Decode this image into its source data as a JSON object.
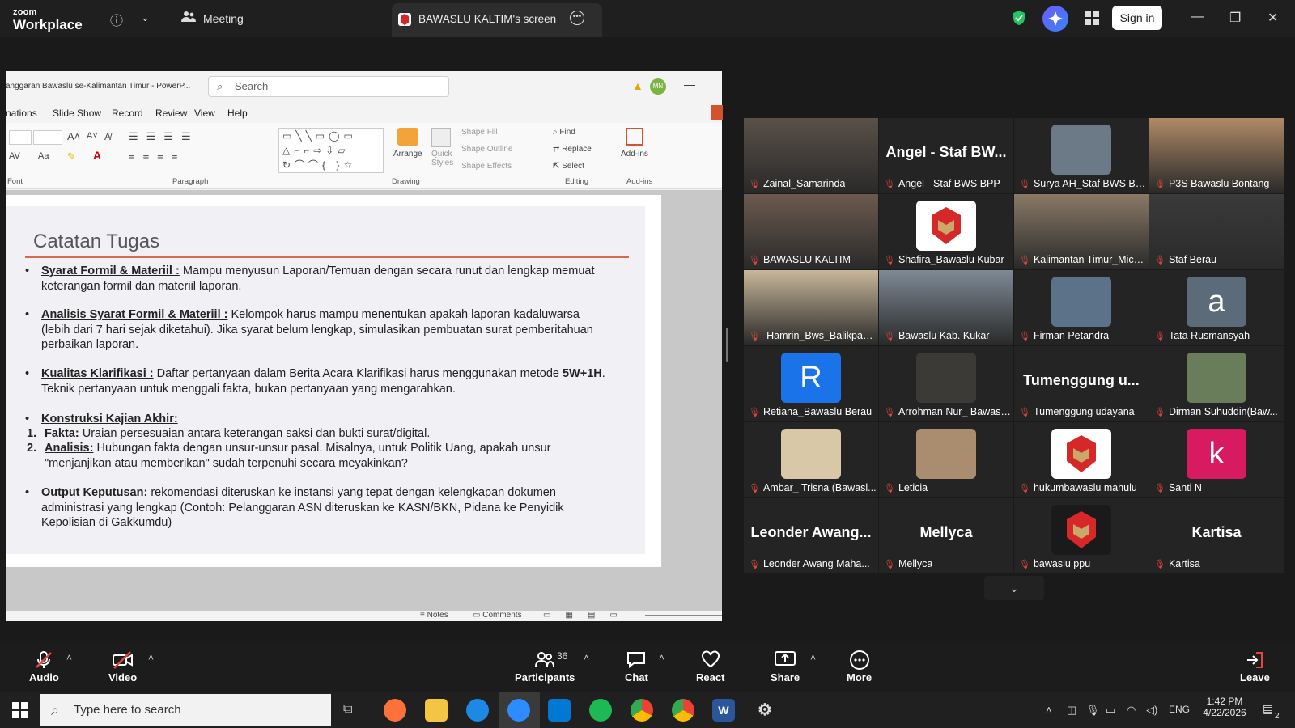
{
  "app": {
    "logo_line1": "zoom",
    "logo_line2": "Workplace",
    "meeting_label": "Meeting",
    "share_tab_title": "BAWASLU KALTIM's screen",
    "sign_in": "Sign in"
  },
  "ppt": {
    "window_title": "anggaran Bawaslu se-Kalimantan Timur - PowerP...",
    "search_placeholder": "Search",
    "user_initials": "MN",
    "menu": [
      "nations",
      "Slide Show",
      "Record",
      "Review",
      "View",
      "Help"
    ],
    "groups": {
      "font": "Font",
      "paragraph": "Paragraph",
      "drawing": "Drawing",
      "editing": "Editing",
      "addins": "Add-ins"
    },
    "ribbon": {
      "arrange": "Arrange",
      "quick_styles": "Quick Styles",
      "shape_fill": "Shape Fill",
      "shape_outline": "Shape Outline",
      "shape_effects": "Shape Effects",
      "find": "Find",
      "replace": "Replace",
      "select": "Select",
      "addins": "Add-ins"
    },
    "status": {
      "notes": "Notes",
      "comments": "Comments"
    }
  },
  "slide": {
    "title": "Catatan Tugas",
    "b1_head": "Syarat Formil & Materiil :",
    "b1_text": " Mampu menyusun Laporan/Temuan dengan secara runut dan lengkap memuat keterangan formil dan materiil laporan.",
    "b2_head": "Analisis Syarat Formil & Materiil :",
    "b2_text": " Kelompok harus mampu menentukan apakah laporan kadaluwarsa (lebih dari 7 hari sejak diketahui). Jika syarat belum lengkap, simulasikan pembuatan surat pemberitahuan perbaikan laporan.",
    "b3_head": "Kualitas Klarifikasi :",
    "b3_text": " Daftar pertanyaan dalam Berita Acara Klarifikasi harus menggunakan metode ",
    "b3_bold": "5W+1H",
    "b3_text2": ". Teknik pertanyaan untuk menggali fakta, bukan pertanyaan yang mengarahkan.",
    "b4_head": "Konstruksi Kajian Akhir:",
    "n1_num": "1.",
    "n1_head": "Fakta:",
    "n1_text": " Uraian persesuaian antara keterangan saksi dan bukti surat/digital.",
    "n2_num": "2.",
    "n2_head": "Analisis:",
    "n2_text": " Hubungan fakta dengan unsur-unsur pasal. Misalnya, untuk Politik Uang, apakah unsur \"menjanjikan atau memberikan\" sudah terpenuhi secara meyakinkan?",
    "b5_head": "Output Keputusan:",
    "b5_text": " rekomendasi diteruskan ke instansi yang tepat dengan kelengkapan dokumen administrasi yang lengkap (Contoh: Pelanggaran ASN diteruskan ke KASN/BKN, Pidana ke Penyidik Kepolisian di Gakkumdu)"
  },
  "participants": [
    {
      "name": "Zainal_Samarinda",
      "kind": "photo",
      "color": "#5a5148"
    },
    {
      "name": "Angel - Staf BWS BPP",
      "kind": "text",
      "display": "Angel - Staf BW..."
    },
    {
      "name": "Surya AH_Staf BWS BPP",
      "kind": "photo",
      "color": "#6c7a88"
    },
    {
      "name": "P3S Bawaslu Bontang",
      "kind": "photo",
      "color": "#b08a66"
    },
    {
      "name": "BAWASLU KALTIM",
      "kind": "photo",
      "color": "#6b5a4e"
    },
    {
      "name": "Shafira_Bawaslu Kubar",
      "kind": "logo",
      "color": "#ffffff"
    },
    {
      "name": "Kalimantan Timur_Michae...",
      "kind": "photo",
      "color": "#8a7a66"
    },
    {
      "name": "Staf Berau",
      "kind": "photo",
      "color": "#3a3a3a"
    },
    {
      "name": "-Hamrin_Bws_Balikpap...",
      "kind": "photo",
      "color": "#c9b79a"
    },
    {
      "name": "Bawaslu Kab. Kukar",
      "kind": "photo",
      "color": "#7e8a96"
    },
    {
      "name": "Firman Petandra",
      "kind": "photo",
      "color": "#5c7288"
    },
    {
      "name": "Tata Rusmansyah",
      "kind": "avatar",
      "letter": "a",
      "color": "#5b6b7a"
    },
    {
      "name": "Retiana_Bawaslu Berau",
      "kind": "avatar",
      "letter": "R",
      "color": "#1a73e8"
    },
    {
      "name": "Arrohman Nur_ Bawaslu ...",
      "kind": "photo",
      "color": "#3c3a36"
    },
    {
      "name": "Tumenggung udayana",
      "kind": "text",
      "display": "Tumenggung u..."
    },
    {
      "name": "Dirman Suhuddin(Baw...",
      "kind": "photo",
      "color": "#6a7d5a"
    },
    {
      "name": "Ambar_ Trisna (Bawasl...",
      "kind": "photo",
      "color": "#d8c8a8"
    },
    {
      "name": "Leticia",
      "kind": "photo",
      "color": "#a98d6e"
    },
    {
      "name": "hukumbawaslu mahulu",
      "kind": "logo2",
      "color": "#ffffff"
    },
    {
      "name": "Santi N",
      "kind": "avatar",
      "letter": "k",
      "color": "#d81b60"
    },
    {
      "name": "Leonder Awang Maha...",
      "kind": "text",
      "display": "Leonder Awang..."
    },
    {
      "name": "Mellyca",
      "kind": "text",
      "display": "Mellyca"
    },
    {
      "name": "bawaslu ppu",
      "kind": "logo",
      "color": "#1a1a1a"
    },
    {
      "name": "Kartisa",
      "kind": "text",
      "display": "Kartisa"
    }
  ],
  "toolbar": {
    "audio": "Audio",
    "video": "Video",
    "participants": "Participants",
    "participant_count": "36",
    "chat": "Chat",
    "react": "React",
    "share": "Share",
    "more": "More",
    "leave": "Leave"
  },
  "taskbar": {
    "search_placeholder": "Type here to search",
    "lang": "ENG",
    "time": "1:42 PM",
    "date": "4/22/2026",
    "notif_count": "2"
  },
  "colors": {
    "active_speaker": "#3ddc84",
    "muted": "#e5463c",
    "slide_accent": "#d9684c"
  }
}
